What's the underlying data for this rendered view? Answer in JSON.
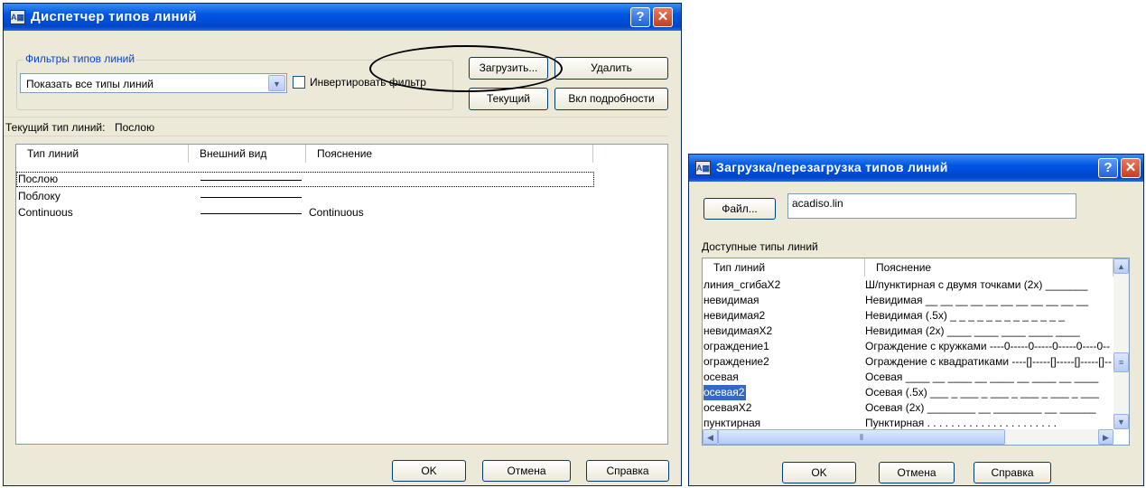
{
  "dialog1": {
    "title": "Диспетчер типов линий",
    "filter_group_label": "Фильтры типов линий",
    "filter_dropdown_value": "Показать все типы линий",
    "invert_filter_label": "Инвертировать фильтр",
    "invert_filter_checked": false,
    "buttons": {
      "load": "Загрузить...",
      "delete": "Удалить",
      "current": "Текущий",
      "details": "Вкл подробности",
      "ok": "OK",
      "cancel": "Отмена",
      "help": "Справка"
    },
    "current_linetype_label": "Текущий тип линий:",
    "current_linetype_value": "Послою",
    "table": {
      "columns": [
        "Тип линий",
        "Внешний вид",
        "Пояснение"
      ],
      "rows": [
        {
          "name": "Послою",
          "description": ""
        },
        {
          "name": "Поблоку",
          "description": ""
        },
        {
          "name": "Continuous",
          "description": "Continuous"
        }
      ]
    }
  },
  "dialog2": {
    "title": "Загрузка/перезагрузка типов линий",
    "file_button": "Файл...",
    "file_value": "acadiso.lin",
    "available_label": "Доступные типы линий",
    "table": {
      "columns": [
        "Тип линий",
        "Пояснение"
      ],
      "rows": [
        {
          "name": "линия_сгибаX2",
          "description": "Ш/пунктирная с двумя точками (2x) _______"
        },
        {
          "name": "невидимая",
          "description": "Невидимая __ __ __ __ __ __ __ __ __ __ __"
        },
        {
          "name": "невидимая2",
          "description": "Невидимая (.5x) _ _ _ _ _ _ _ _ _ _ _ _ _"
        },
        {
          "name": "невидимаяX2",
          "description": "Невидимая (2x) ____ ____ ____ ____ ____"
        },
        {
          "name": "ограждение1",
          "description": "Ограждение с кружками ----0-----0-----0-----0----0--"
        },
        {
          "name": "ограждение2",
          "description": "Ограждение с квадратиками ----[]-----[]-----[]-----[]--"
        },
        {
          "name": "осевая",
          "description": "Осевая ____ __ ____ __ ____ __ ____ __ ____"
        },
        {
          "name": "осевая2",
          "description": "Осевая (.5x) ___ _ ___ _ ___ _ ___ _ ___ _ ___"
        },
        {
          "name": "осеваяX2",
          "description": "Осевая (2x) ________ __ ________ __ ______"
        },
        {
          "name": "пунктирная",
          "description": "Пунктирная . . . . . . . . . . . . . . . . . . . . . ."
        }
      ],
      "selected_index": 7
    },
    "buttons": {
      "ok": "OK",
      "cancel": "Отмена",
      "help": "Справка"
    }
  },
  "icons": {
    "app": "autocad-app-icon",
    "help": "help-icon",
    "close": "close-icon",
    "dropdown": "chevron-down-icon"
  },
  "colors": {
    "titlebar": "#0055e5",
    "dialog_bg": "#ece9d8",
    "group_label": "#0046d5",
    "selection": "#316ac5",
    "close_button": "#c3401f"
  }
}
